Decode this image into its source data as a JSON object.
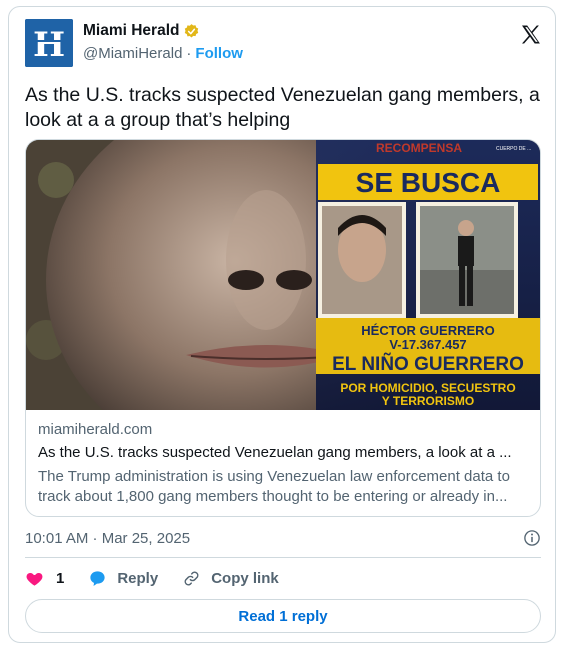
{
  "account": {
    "display_name": "Miami Herald",
    "handle": "@MiamiHerald",
    "separator": "·",
    "follow_label": "Follow",
    "logo_letter": "H"
  },
  "tweet": {
    "text": "As the U.S. tracks suspected Venezuelan gang members, a look at a a group that’s helping"
  },
  "link_card": {
    "poster": {
      "top_text": "RECOMPENSA",
      "headline": "SE BUSCA",
      "name": "HÉCTOR GUERRERO",
      "id_number": "V-17.367.457",
      "alias": "EL NIÑO GUERRERO",
      "charges_line1": "POR HOMICIDIO, SECUESTRO",
      "charges_line2": "Y TERRORISMO",
      "corner_text": "CUERPO DE ..."
    },
    "domain": "miamiherald.com",
    "title": "As the U.S. tracks suspected Venezuelan gang members, a look at a ...",
    "description": "The Trump administration is using Venezuelan law enforcement data to track about 1,800 gang members thought to be entering or already in..."
  },
  "timestamp": "10:01 AM · Mar 25, 2025",
  "actions": {
    "like_count": "1",
    "reply_label": "Reply",
    "copy_label": "Copy link"
  },
  "read_reply_label": "Read 1 reply",
  "colors": {
    "accent": "#1d9bf0",
    "like": "#f91880",
    "poster_yellow": "#f1c40f",
    "poster_navy": "#1a2a5e"
  }
}
